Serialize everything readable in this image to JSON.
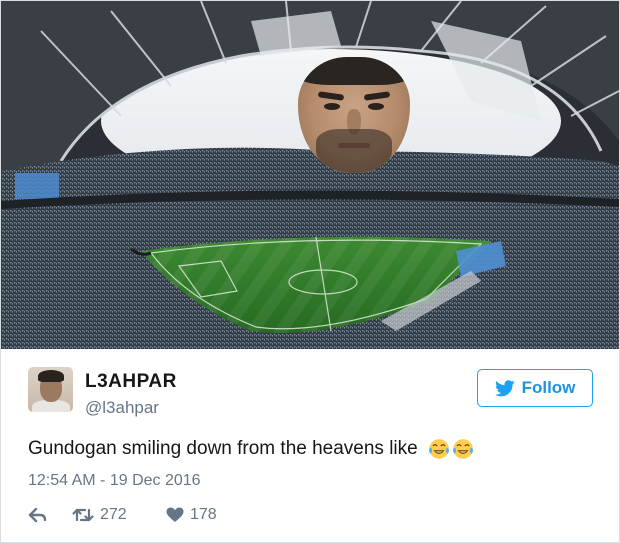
{
  "tweet": {
    "display_name": "L3AHPAR",
    "handle": "@l3ahpar",
    "follow_label": "Follow",
    "text": "Gundogan smiling down from the heavens like",
    "emojis": [
      "face-with-tears-of-joy",
      "face-with-tears-of-joy"
    ],
    "timestamp": "12:54 AM - 19 Dec 2016",
    "retweet_count": "272",
    "like_count": "178"
  },
  "colors": {
    "accent": "#1da1f2",
    "text": "#14171a",
    "muted": "#657786",
    "pitch": "#2f7d2a"
  },
  "icons": {
    "reply": "reply-arrow-icon",
    "retweet": "retweet-icon",
    "like": "heart-icon",
    "follow": "twitter-bird-icon"
  }
}
